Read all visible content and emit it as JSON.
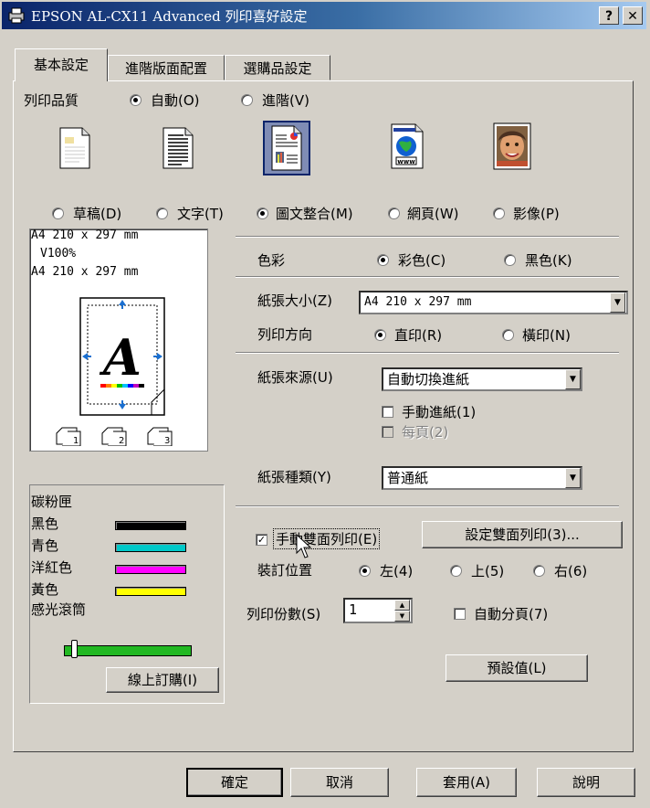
{
  "window": {
    "title": "EPSON AL-CX11 Advanced 列印喜好設定",
    "help_label": "?",
    "close_label": "✕"
  },
  "tabs": [
    {
      "label": "基本設定",
      "active": true
    },
    {
      "label": "進階版面配置",
      "active": false
    },
    {
      "label": "選購品設定",
      "active": false
    }
  ],
  "quality": {
    "label": "列印品質",
    "auto": "自動(O)",
    "advanced": "進階(V)",
    "selected": "auto"
  },
  "modes": [
    {
      "label": "草稿(D)",
      "icon": "draft-document-icon",
      "selected": false
    },
    {
      "label": "文字(T)",
      "icon": "text-document-icon",
      "selected": false
    },
    {
      "label": "圖文整合(M)",
      "icon": "text-graph-document-icon",
      "selected": true
    },
    {
      "label": "網頁(W)",
      "icon": "web-page-icon",
      "selected": false
    },
    {
      "label": "影像(P)",
      "icon": "photo-image-icon",
      "selected": false
    }
  ],
  "preview": {
    "line1": "A4 210 x 297 mm",
    "line2": "V100%",
    "line3": "A4 210 x 297 mm",
    "letter": "A",
    "copy_icons": [
      "1",
      "2",
      "3"
    ]
  },
  "color": {
    "label": "色彩",
    "color_option": "彩色(C)",
    "mono_option": "黑色(K)",
    "selected": "color"
  },
  "paper": {
    "size_label": "紙張大小(Z)",
    "size_value": "A4 210 x 297 mm",
    "orientation_label": "列印方向",
    "portrait": "直印(R)",
    "landscape": "橫印(N)",
    "orientation_selected": "portrait",
    "source_label": "紙張來源(U)",
    "source_value": "自動切換進紙",
    "manual_feed": "手動進紙(1)",
    "each_page": "每頁(2)",
    "type_label": "紙張種類(Y)",
    "type_value": "普通紙"
  },
  "duplex": {
    "manual_duplex": "手動雙面列印(E)",
    "manual_duplex_checked": true,
    "settings_button": "設定雙面列印(3)...",
    "binding_label": "裝訂位置",
    "left": "左(4)",
    "top": "上(5)",
    "right": "右(6)",
    "binding_selected": "left"
  },
  "copies": {
    "label": "列印份數(S)",
    "value": "1",
    "collate": "自動分頁(7)",
    "collate_checked": false
  },
  "defaults_button": "預設值(L)",
  "toner": {
    "title": "碳粉匣",
    "items": [
      {
        "label": "黑色",
        "color": "#000000"
      },
      {
        "label": "青色",
        "color": "#00c8c8"
      },
      {
        "label": "洋紅色",
        "color": "#ff00ff"
      },
      {
        "label": "黃色",
        "color": "#ffff00"
      }
    ],
    "photoconductor_label": "感光滾筒",
    "photoconductor_color": "#22b822",
    "order_button": "線上訂購(I)"
  },
  "footer": {
    "ok": "確定",
    "cancel": "取消",
    "apply": "套用(A)",
    "help": "說明"
  }
}
